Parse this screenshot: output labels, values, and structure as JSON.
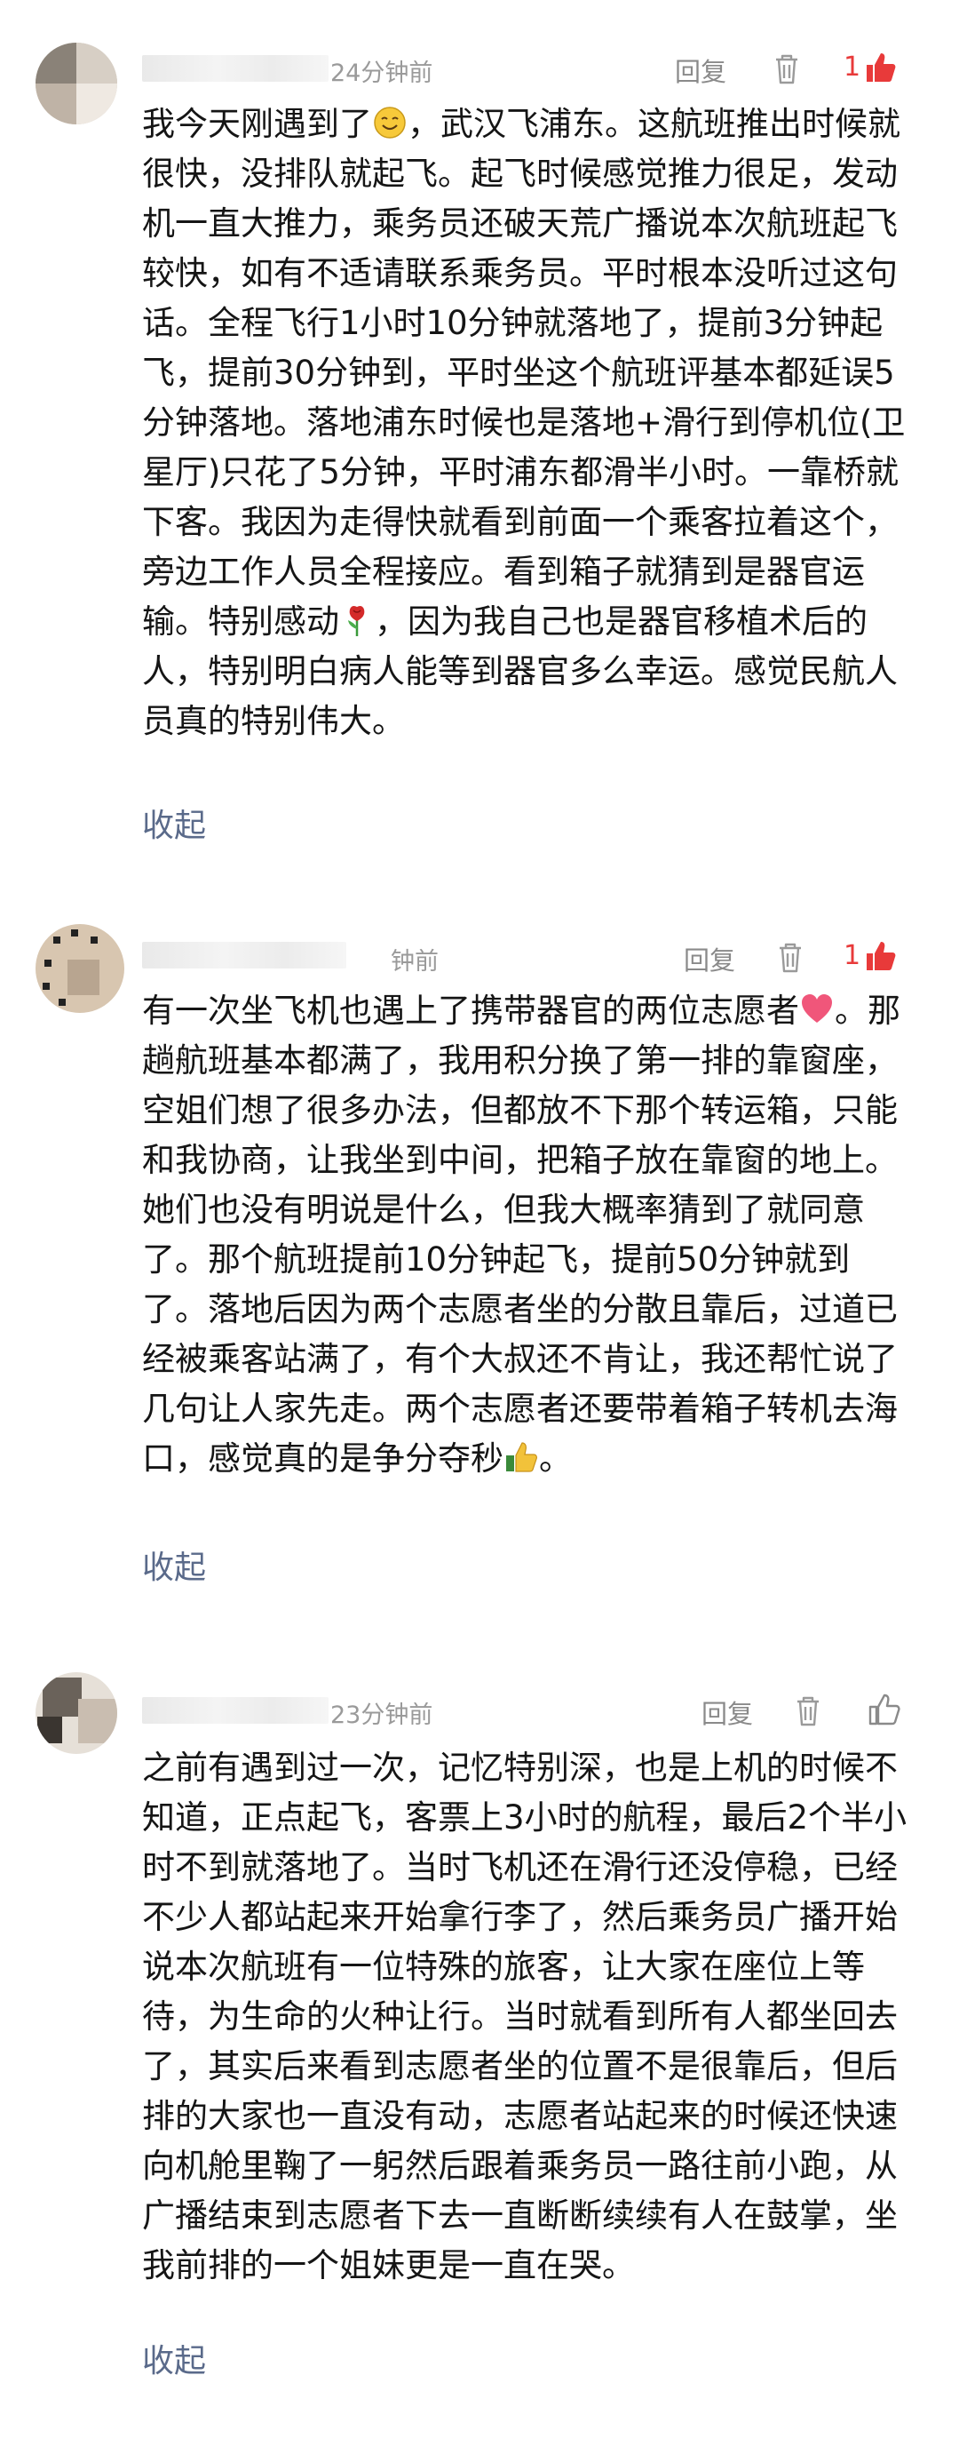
{
  "comments": [
    {
      "time": "24分钟前",
      "reply_label": "回复",
      "like_count": "1",
      "text_a": "我今天刚遇到了",
      "text_b": "，武汉飞浦东。这航班推出时候就很快，没排队就起飞。起飞时候感觉推力很足，发动机一直大推力，乘务员还破天荒广播说本次航班起飞较快，如有不适请联系乘务员。平时根本没听过这句话。全程飞行1小时10分钟就落地了，提前3分钟起飞，提前30分钟到，平时坐这个航班评基本都延误5分钟落地。落地浦东时候也是落地+滑行到停机位(卫星厅)只花了5分钟，平时浦东都滑半小时。一靠桥就下客。我因为走得快就看到前面一个乘客拉着这个，旁边工作人员全程接应。看到箱子就猜到是器官运输。特别感动",
      "text_c": "，因为我自己也是器官移植术后的人，特别明白病人能等到器官多么幸运。感觉民航人员真的特别伟大。",
      "collapse_label": "收起"
    },
    {
      "time": "钟前",
      "reply_label": "回复",
      "like_count": "1",
      "text_a": "有一次坐飞机也遇上了携带器官的两位志愿者",
      "text_b": "。那趟航班基本都满了，我用积分换了第一排的靠窗座，空姐们想了很多办法，但都放不下那个转运箱，只能和我协商，让我坐到中间，把箱子放在靠窗的地上。她们也没有明说是什么，但我大概率猜到了就同意了。那个航班提前10分钟起飞，提前50分钟就到了。落地后因为两个志愿者坐的分散且靠后，过道已经被乘客站满了，有个大叔还不肯让，我还帮忙说了几句让人家先走。两个志愿者还要带着箱子转机去海口，感觉真的是争分夺秒",
      "text_c": "。",
      "collapse_label": "收起"
    },
    {
      "time": "23分钟前",
      "reply_label": "回复",
      "text_a": "之前有遇到过一次，记忆特别深，也是上机的时候不知道，正点起飞，客票上3小时的航程，最后2个半小时不到就落地了。当时飞机还在滑行还没停稳，已经不少人都站起来开始拿行李了，然后乘务员广播开始说本次航班有一位特殊的旅客，让大家在座位上等待，为生命的火种让行。当时就看到所有人都坐回去了，其实后来看到志愿者坐的位置不是很靠后，但后排的大家也一直没有动，志愿者站起来的时候还快速向机舱里鞠了一躬然后跟着乘务员一路往前小跑，从广播结束到志愿者下去一直断断续续有人在鼓掌，坐我前排的一个姐妹更是一直在哭。",
      "collapse_label": "收起"
    }
  ],
  "colors": {
    "accent_red": "#e83a3a",
    "link": "#5a6a8a",
    "meta": "#9a9a9a"
  }
}
